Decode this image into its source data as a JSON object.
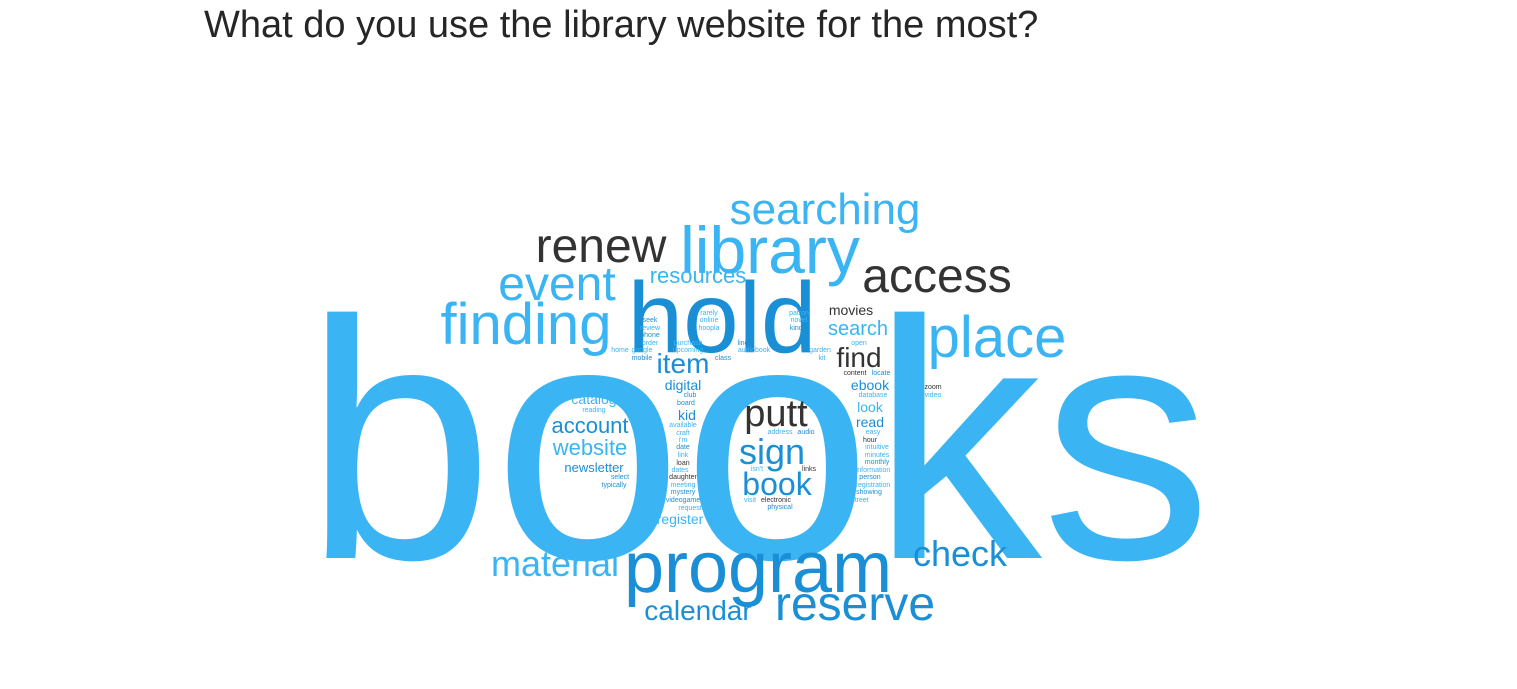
{
  "page": {
    "title": "What do you use the library website for the most?"
  },
  "colors": {
    "blue": "#3ab4f2",
    "mid_blue": "#1a8fd6",
    "dark": "#333333"
  },
  "chart_data": {
    "type": "wordcloud",
    "title": "What do you use the library website for the most?",
    "words": [
      {
        "text": "books",
        "weight": 100,
        "color": "blue"
      },
      {
        "text": "hold",
        "weight": 30,
        "color": "mid_blue"
      },
      {
        "text": "program",
        "weight": 22,
        "color": "mid_blue"
      },
      {
        "text": "library",
        "weight": 18,
        "color": "blue"
      },
      {
        "text": "finding",
        "weight": 16,
        "color": "blue"
      },
      {
        "text": "place",
        "weight": 16,
        "color": "blue"
      },
      {
        "text": "renew",
        "weight": 15,
        "color": "dark"
      },
      {
        "text": "access",
        "weight": 14,
        "color": "dark"
      },
      {
        "text": "event",
        "weight": 14,
        "color": "blue"
      },
      {
        "text": "reserve",
        "weight": 13,
        "color": "mid_blue"
      },
      {
        "text": "searching",
        "weight": 12,
        "color": "blue"
      },
      {
        "text": "putt",
        "weight": 11,
        "color": "dark"
      },
      {
        "text": "material",
        "weight": 10,
        "color": "blue"
      },
      {
        "text": "sign",
        "weight": 10,
        "color": "mid_blue"
      },
      {
        "text": "check",
        "weight": 10,
        "color": "mid_blue"
      },
      {
        "text": "book",
        "weight": 9,
        "color": "mid_blue"
      },
      {
        "text": "find",
        "weight": 8,
        "color": "dark"
      },
      {
        "text": "item",
        "weight": 8,
        "color": "mid_blue"
      },
      {
        "text": "calendar",
        "weight": 7,
        "color": "mid_blue"
      },
      {
        "text": "account",
        "weight": 6,
        "color": "mid_blue"
      },
      {
        "text": "website",
        "weight": 6,
        "color": "blue"
      },
      {
        "text": "resources",
        "weight": 5,
        "color": "blue"
      },
      {
        "text": "search",
        "weight": 5,
        "color": "blue"
      },
      {
        "text": "register",
        "weight": 4,
        "color": "blue"
      },
      {
        "text": "digital",
        "weight": 4,
        "color": "mid_blue"
      },
      {
        "text": "ebook",
        "weight": 4,
        "color": "mid_blue"
      },
      {
        "text": "newsletter",
        "weight": 4,
        "color": "mid_blue"
      },
      {
        "text": "movies",
        "weight": 4,
        "color": "dark"
      },
      {
        "text": "kid",
        "weight": 3,
        "color": "mid_blue"
      },
      {
        "text": "look",
        "weight": 3,
        "color": "blue"
      },
      {
        "text": "read",
        "weight": 3,
        "color": "mid_blue"
      },
      {
        "text": "catalog",
        "weight": 3,
        "color": "blue"
      },
      {
        "text": "zoom",
        "weight": 1,
        "color": "dark"
      },
      {
        "text": "video",
        "weight": 1,
        "color": "blue"
      },
      {
        "text": "patron",
        "weight": 1,
        "color": "blue"
      },
      {
        "text": "novel",
        "weight": 1,
        "color": "blue"
      },
      {
        "text": "kindle",
        "weight": 1,
        "color": "mid_blue"
      },
      {
        "text": "rarely",
        "weight": 1,
        "color": "blue"
      },
      {
        "text": "online",
        "weight": 1,
        "color": "blue"
      },
      {
        "text": "hoopla",
        "weight": 1,
        "color": "blue"
      },
      {
        "text": "seek",
        "weight": 1,
        "color": "mid_blue"
      },
      {
        "text": "review",
        "weight": 1,
        "color": "blue"
      },
      {
        "text": "phone",
        "weight": 1,
        "color": "mid_blue"
      },
      {
        "text": "order",
        "weight": 1,
        "color": "blue"
      },
      {
        "text": "home",
        "weight": 1,
        "color": "blue"
      },
      {
        "text": "google",
        "weight": 1,
        "color": "blue"
      },
      {
        "text": "mobile",
        "weight": 1,
        "color": "mid_blue"
      },
      {
        "text": "purchase",
        "weight": 1,
        "color": "blue"
      },
      {
        "text": "upcoming",
        "weight": 1,
        "color": "blue"
      },
      {
        "text": "line",
        "weight": 1,
        "color": "mid_blue"
      },
      {
        "text": "audiobook",
        "weight": 1,
        "color": "blue"
      },
      {
        "text": "class",
        "weight": 1,
        "color": "mid_blue"
      },
      {
        "text": "garden",
        "weight": 1,
        "color": "blue"
      },
      {
        "text": "kit",
        "weight": 1,
        "color": "blue"
      },
      {
        "text": "open",
        "weight": 1,
        "color": "blue"
      },
      {
        "text": "content",
        "weight": 1,
        "color": "dark"
      },
      {
        "text": "locate",
        "weight": 1,
        "color": "mid_blue"
      },
      {
        "text": "database",
        "weight": 1,
        "color": "blue"
      },
      {
        "text": "club",
        "weight": 1,
        "color": "mid_blue"
      },
      {
        "text": "board",
        "weight": 1,
        "color": "mid_blue"
      },
      {
        "text": "reading",
        "weight": 1,
        "color": "blue"
      },
      {
        "text": "available",
        "weight": 1,
        "color": "blue"
      },
      {
        "text": "craft",
        "weight": 1,
        "color": "blue"
      },
      {
        "text": "i'm",
        "weight": 1,
        "color": "blue"
      },
      {
        "text": "date",
        "weight": 1,
        "color": "mid_blue"
      },
      {
        "text": "link",
        "weight": 1,
        "color": "blue"
      },
      {
        "text": "loan",
        "weight": 1,
        "color": "dark"
      },
      {
        "text": "dates",
        "weight": 1,
        "color": "blue"
      },
      {
        "text": "daughter",
        "weight": 1,
        "color": "dark"
      },
      {
        "text": "meeting",
        "weight": 1,
        "color": "blue"
      },
      {
        "text": "mystery",
        "weight": 1,
        "color": "mid_blue"
      },
      {
        "text": "videogame",
        "weight": 1,
        "color": "mid_blue"
      },
      {
        "text": "request",
        "weight": 1,
        "color": "blue"
      },
      {
        "text": "select",
        "weight": 1,
        "color": "mid_blue"
      },
      {
        "text": "typically",
        "weight": 1,
        "color": "mid_blue"
      },
      {
        "text": "address",
        "weight": 1,
        "color": "blue"
      },
      {
        "text": "audio",
        "weight": 1,
        "color": "mid_blue"
      },
      {
        "text": "isn't",
        "weight": 1,
        "color": "blue"
      },
      {
        "text": "links",
        "weight": 1,
        "color": "dark"
      },
      {
        "text": "visit",
        "weight": 1,
        "color": "blue"
      },
      {
        "text": "electronic",
        "weight": 1,
        "color": "dark"
      },
      {
        "text": "physical",
        "weight": 1,
        "color": "mid_blue"
      },
      {
        "text": "easy",
        "weight": 1,
        "color": "blue"
      },
      {
        "text": "hour",
        "weight": 1,
        "color": "dark"
      },
      {
        "text": "intuitive",
        "weight": 1,
        "color": "blue"
      },
      {
        "text": "minutes",
        "weight": 1,
        "color": "blue"
      },
      {
        "text": "monthly",
        "weight": 1,
        "color": "mid_blue"
      },
      {
        "text": "information",
        "weight": 1,
        "color": "blue"
      },
      {
        "text": "person",
        "weight": 1,
        "color": "mid_blue"
      },
      {
        "text": "registration",
        "weight": 1,
        "color": "blue"
      },
      {
        "text": "showing",
        "weight": 1,
        "color": "mid_blue"
      },
      {
        "text": "street",
        "weight": 1,
        "color": "blue"
      }
    ]
  }
}
